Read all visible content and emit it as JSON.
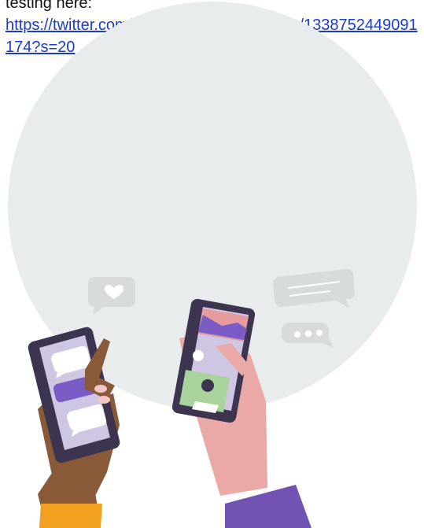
{
  "post": {
    "intro_text": "testing here:",
    "link_text": "https://twitter.com/10DowningStreet/status/1338752449091174?s=20"
  },
  "illustration": {
    "description_name": "phones-social-illustration",
    "colors": {
      "backdrop": "#e8eced",
      "bubble_gray": "#d7dbdc",
      "phone_body": "#3d3450",
      "screen_lavender": "#cfc6e3",
      "accent_purple": "#7a5cc4",
      "skin_dark": "#8a5a38",
      "skin_light": "#eaa9a6",
      "sleeve_orange": "#f2a01f",
      "sleeve_purple": "#7253b2"
    }
  }
}
